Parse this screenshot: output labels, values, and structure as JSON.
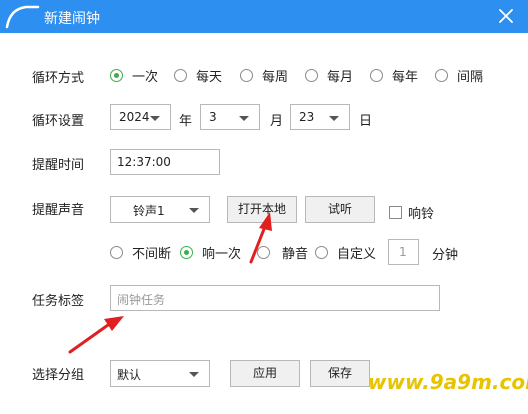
{
  "titlebar": {
    "title": "新建闹钟"
  },
  "cycle": {
    "label": "循环方式",
    "options": [
      "一次",
      "每天",
      "每周",
      "每月",
      "每年",
      "间隔"
    ],
    "selected": "一次"
  },
  "cycle_setting": {
    "label": "循环设置",
    "year": "2024",
    "year_unit": "年",
    "month": "3",
    "month_unit": "月",
    "day": "23",
    "day_unit": "日"
  },
  "remind_time": {
    "label": "提醒时间",
    "value": "12:37:00"
  },
  "sound": {
    "label": "提醒声音",
    "select_value": "铃声1",
    "open_local_button": "打开本地",
    "preview_button": "试听",
    "ring_checkbox": "响铃",
    "mode_options": [
      "不间断",
      "响一次",
      "静音",
      "自定义"
    ],
    "mode_selected": "响一次",
    "custom_minutes": "1",
    "minutes_unit": "分钟"
  },
  "task_tag": {
    "label": "任务标签",
    "placeholder": "闹钟任务"
  },
  "group": {
    "label": "选择分组",
    "select_value": "默认",
    "apply_button": "应用",
    "save_button": "保存"
  },
  "watermark": "www.9a9m.com",
  "colors": {
    "titlebar": "#2d8ff0",
    "radio_checked": "#3cae4a",
    "annotation_arrow": "#e02020",
    "watermark": "#e8c300"
  }
}
